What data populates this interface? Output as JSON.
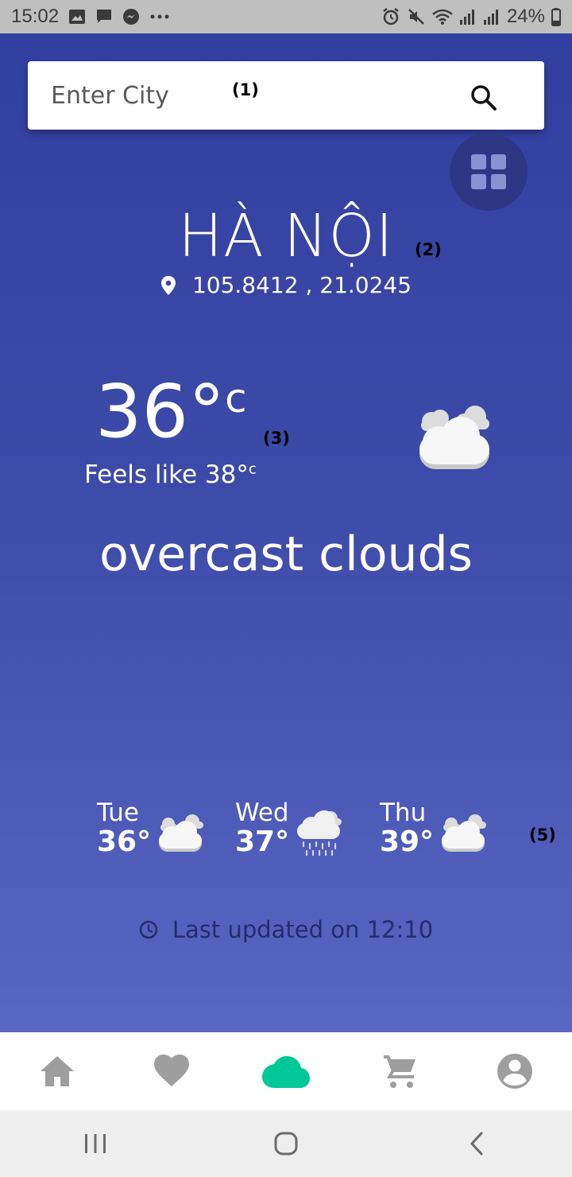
{
  "status_bar": {
    "time": "15:02",
    "notification_icons": [
      "image-icon",
      "chat-icon",
      "messenger-icon",
      "more-dots-icon"
    ],
    "system_icons": [
      "alarm-icon",
      "mute-icon",
      "wifi-icon",
      "signal-icon",
      "signal-icon"
    ],
    "battery": "24%"
  },
  "search": {
    "placeholder": "Enter City",
    "icon": "search-icon"
  },
  "annotations": {
    "a1": "(1)",
    "a2": "(2)",
    "a3": "(3)",
    "a5": "(5)"
  },
  "location": {
    "city": "HÀ NỘI",
    "coordinates": "105.8412 , 21.0245"
  },
  "current": {
    "temperature": "36°",
    "unit": "c",
    "feels_like_label": "Feels like 38°",
    "feels_like_unit": "c",
    "description": "overcast clouds",
    "icon": "clouds-icon"
  },
  "forecast": [
    {
      "day": "Tue",
      "temp": "36°",
      "icon": "clouds-icon"
    },
    {
      "day": "Wed",
      "temp": "37°",
      "icon": "rain-cloud-icon"
    },
    {
      "day": "Thu",
      "temp": "39°",
      "icon": "clouds-icon"
    }
  ],
  "last_updated": "Last updated on 12:10",
  "bottom_nav": {
    "items": [
      "home-icon",
      "heart-icon",
      "cloud-icon",
      "cart-icon",
      "account-icon"
    ],
    "active_index": 2,
    "active_color": "#00c896",
    "inactive_color": "#9e9e9e"
  },
  "colors": {
    "background_top": "#323fa0",
    "background_bottom": "#5966c2",
    "grid_button": "#2e3785"
  }
}
